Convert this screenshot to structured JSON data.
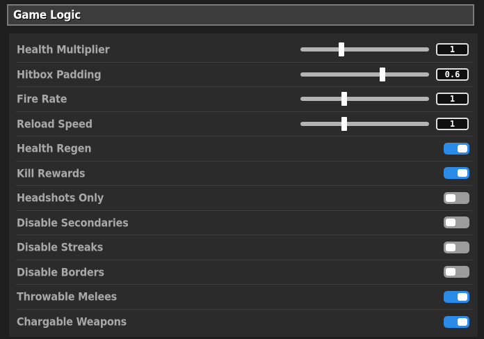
{
  "header": {
    "title": "Game Logic"
  },
  "settings": [
    {
      "label": "Health Multiplier",
      "type": "slider",
      "value": "1",
      "level": 0.32
    },
    {
      "label": "Hitbox Padding",
      "type": "slider",
      "value": "0.6",
      "level": 0.64
    },
    {
      "label": "Fire Rate",
      "type": "slider",
      "value": "1",
      "level": 0.34
    },
    {
      "label": "Reload Speed",
      "type": "slider",
      "value": "1",
      "level": 0.34
    },
    {
      "label": "Health Regen",
      "type": "toggle",
      "on": true
    },
    {
      "label": "Kill Rewards",
      "type": "toggle",
      "on": true
    },
    {
      "label": "Headshots Only",
      "type": "toggle",
      "on": false
    },
    {
      "label": "Disable Secondaries",
      "type": "toggle",
      "on": false
    },
    {
      "label": "Disable Streaks",
      "type": "toggle",
      "on": false
    },
    {
      "label": "Disable Borders",
      "type": "toggle",
      "on": false
    },
    {
      "label": "Throwable Melees",
      "type": "toggle",
      "on": true
    },
    {
      "label": "Chargable Weapons",
      "type": "toggle",
      "on": true
    }
  ],
  "colors": {
    "toggle_on": "#2a8be8",
    "toggle_off": "#9c9c9c",
    "label": "#a8a8a8",
    "background": "#1e1e1e",
    "panel": "#2b2b2b"
  }
}
